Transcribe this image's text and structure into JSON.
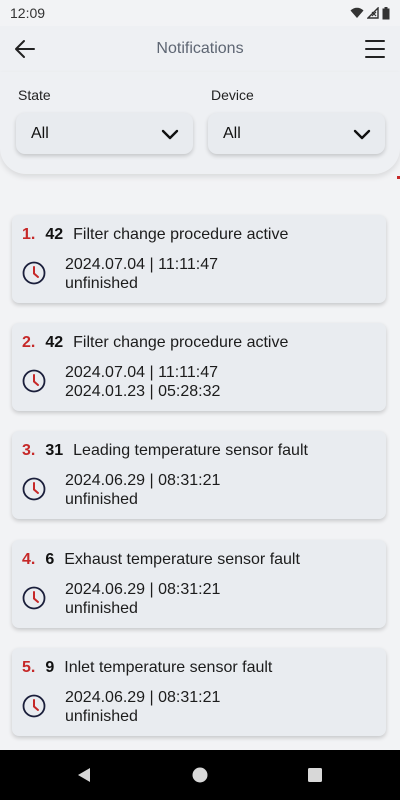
{
  "status_bar": {
    "time": "12:09"
  },
  "header": {
    "title": "Notifications",
    "back_icon": "arrow-left-icon",
    "menu_icon": "hamburger-menu-icon"
  },
  "filters": {
    "state": {
      "label": "State",
      "value": "All"
    },
    "device": {
      "label": "Device",
      "value": "All"
    }
  },
  "colors": {
    "accent": "#c62828",
    "icon_dark": "#1b1f3b",
    "card_bg": "#e9ecf0"
  },
  "notifications": [
    {
      "index": "1.",
      "code": "42",
      "message": "Filter change procedure active",
      "start": "2024.07.04 | 11:11:47",
      "end": "unfinished"
    },
    {
      "index": "2.",
      "code": "42",
      "message": "Filter change procedure active",
      "start": "2024.07.04 | 11:11:47",
      "end": "2024.01.23 | 05:28:32"
    },
    {
      "index": "3.",
      "code": "31",
      "message": "Leading temperature sensor fault",
      "start": "2024.06.29 | 08:31:21",
      "end": "unfinished"
    },
    {
      "index": "4.",
      "code": "6",
      "message": "Exhaust temperature sensor fault",
      "start": "2024.06.29 | 08:31:21",
      "end": "unfinished"
    },
    {
      "index": "5.",
      "code": "9",
      "message": "Inlet temperature sensor fault",
      "start": "2024.06.29 | 08:31:21",
      "end": "unfinished"
    }
  ]
}
